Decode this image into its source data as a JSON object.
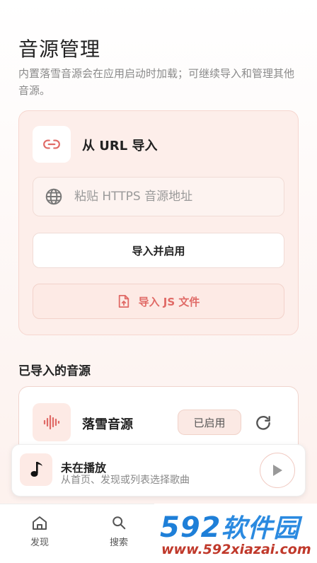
{
  "page": {
    "title": "音源管理",
    "subtitle": "内置落雪音源会在应用启动时加载；可继续导入和管理其他音源。"
  },
  "import_card": {
    "icon": "link-icon",
    "title": "从 URL 导入",
    "input_placeholder": "粘贴 HTTPS 音源地址",
    "input_value": "",
    "import_enable_label": "导入并启用",
    "import_js_label": "导入 JS 文件"
  },
  "imported": {
    "section_title": "已导入的音源",
    "sources": [
      {
        "name": "落雪音源",
        "status": "已启用",
        "icon": "waveform-icon"
      }
    ]
  },
  "player": {
    "title": "未在播放",
    "subtitle": "从首页、发现或列表选择歌曲",
    "icon": "music-note-icon"
  },
  "nav": {
    "items": [
      {
        "label": "发现",
        "icon": "home-icon"
      },
      {
        "label": "搜索",
        "icon": "search-icon"
      }
    ]
  },
  "watermark": {
    "brand_number": "592",
    "brand_text": "软件园",
    "site": "www.592xiazai.com"
  },
  "colors": {
    "accent": "#e06a66",
    "card_bg": "#fdeeea",
    "watermark_blue": "#1e7fd8",
    "watermark_red": "#c0392b"
  }
}
